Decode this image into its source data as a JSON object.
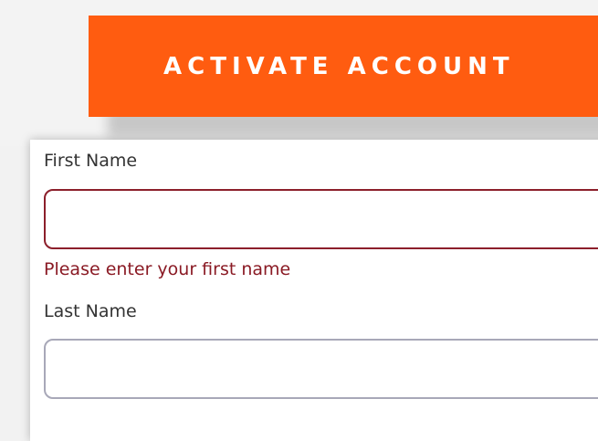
{
  "header": {
    "title": "ACTIVATE ACCOUNT"
  },
  "form": {
    "first_name": {
      "label": "First Name",
      "value": "",
      "placeholder": "",
      "error": "Please enter your first name"
    },
    "last_name": {
      "label": "Last Name",
      "value": "",
      "placeholder": ""
    }
  },
  "colors": {
    "accent": "#ff5c10",
    "error": "#8a1a24",
    "input_border": "#a8a8b8"
  }
}
